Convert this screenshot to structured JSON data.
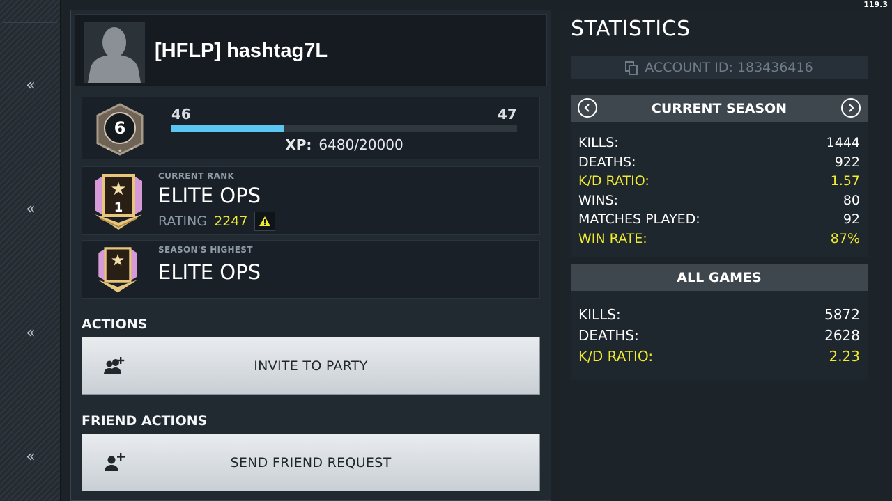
{
  "player": {
    "name": "[HFLP] hashtag7L"
  },
  "level": {
    "badge": "6",
    "current": "46",
    "next": "47",
    "xp_label": "XP:",
    "xp_value": "6480/20000",
    "xp_progress": 0.324
  },
  "current_rank": {
    "caption": "CURRENT RANK",
    "name": "ELITE OPS",
    "tier": "1",
    "rating_label": "RATING",
    "rating_value": "2247"
  },
  "season_highest": {
    "caption": "SEASON'S HIGHEST",
    "name": "ELITE OPS"
  },
  "actions": {
    "title": "ACTIONS",
    "invite_label": "INVITE TO PARTY"
  },
  "friend_actions": {
    "title": "FRIEND ACTIONS",
    "send_request_label": "SEND FRIEND REQUEST"
  },
  "statistics": {
    "title": "STATISTICS",
    "account_id": "ACCOUNT ID: 183436416",
    "current_season": {
      "title": "CURRENT SEASON",
      "rows": [
        {
          "label": "KILLS:",
          "value": "1444"
        },
        {
          "label": "DEATHS:",
          "value": "922"
        },
        {
          "label": "K/D RATIO:",
          "value": "1.57"
        },
        {
          "label": "WINS:",
          "value": "80"
        },
        {
          "label": "MATCHES PLAYED:",
          "value": "92"
        },
        {
          "label": "WIN RATE:",
          "value": "87%"
        }
      ]
    },
    "all_games": {
      "title": "ALL GAMES",
      "rows": [
        {
          "label": "KILLS:",
          "value": "5872"
        },
        {
          "label": "DEATHS:",
          "value": "2628"
        },
        {
          "label": "K/D RATIO:",
          "value": "2.23"
        }
      ]
    }
  },
  "overlay": {
    "fps": "119.3"
  },
  "colors": {
    "accent_yellow": "#f1eb2f",
    "xp_blue": "#5bc6f0",
    "button_bg": "#dde1e5"
  },
  "icons": [
    "double-chevron-left-icon",
    "avatar-silhouette-icon",
    "level-badge-icon",
    "rank-emblem-icon",
    "warning-icon",
    "add-group-icon",
    "add-user-icon",
    "copy-icon",
    "chevron-left-icon",
    "chevron-right-icon"
  ]
}
